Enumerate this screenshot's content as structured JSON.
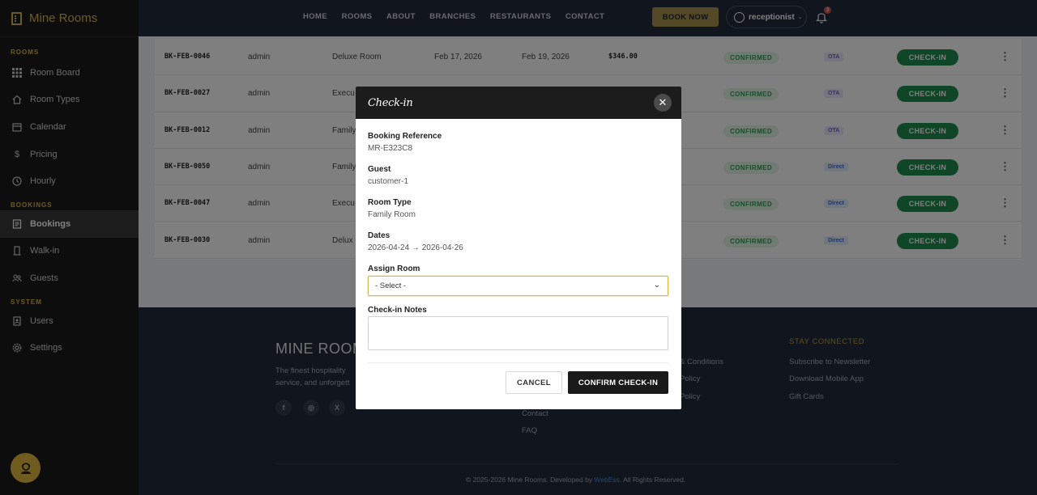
{
  "brand": {
    "name": "Mine Rooms"
  },
  "sidebar": {
    "sections": [
      {
        "title": "ROOMS",
        "items": [
          {
            "label": "Room Board",
            "icon": "grid-icon"
          },
          {
            "label": "Room Types",
            "icon": "home-icon"
          },
          {
            "label": "Calendar",
            "icon": "calendar-icon"
          },
          {
            "label": "Pricing",
            "icon": "dollar-icon"
          },
          {
            "label": "Hourly",
            "icon": "clock-icon"
          }
        ]
      },
      {
        "title": "BOOKINGS",
        "items": [
          {
            "label": "Bookings",
            "icon": "list-icon",
            "active": true
          },
          {
            "label": "Walk-in",
            "icon": "door-icon"
          },
          {
            "label": "Guests",
            "icon": "users-icon"
          }
        ]
      },
      {
        "title": "SYSTEM",
        "items": [
          {
            "label": "Users",
            "icon": "id-card-icon"
          },
          {
            "label": "Settings",
            "icon": "gear-icon"
          }
        ]
      }
    ]
  },
  "topnav": {
    "links": [
      "HOME",
      "ROOMS",
      "ABOUT",
      "BRANCHES",
      "RESTAURANTS",
      "CONTACT"
    ],
    "book_now": "BOOK NOW",
    "user": "receptionist",
    "notifications": "3"
  },
  "bookings": [
    {
      "ref": "BK-FEB-0046",
      "user": "admin",
      "room": "Deluxe Room",
      "check_in": "Feb 17, 2026",
      "check_out": "Feb 19, 2026",
      "price": "$346.00",
      "status": "CONFIRMED",
      "source": "OTA",
      "action": "CHECK-IN"
    },
    {
      "ref": "BK-FEB-0027",
      "user": "admin",
      "room": "Execu",
      "check_in": "",
      "check_out": "",
      "price": "",
      "status": "CONFIRMED",
      "source": "OTA",
      "action": "CHECK-IN"
    },
    {
      "ref": "BK-FEB-0012",
      "user": "admin",
      "room": "Family",
      "check_in": "",
      "check_out": "",
      "price": "",
      "status": "CONFIRMED",
      "source": "OTA",
      "action": "CHECK-IN"
    },
    {
      "ref": "BK-FEB-0050",
      "user": "admin",
      "room": "Family",
      "check_in": "",
      "check_out": "",
      "price": "",
      "status": "CONFIRMED",
      "source": "Direct",
      "action": "CHECK-IN"
    },
    {
      "ref": "BK-FEB-0047",
      "user": "admin",
      "room": "Execu",
      "check_in": "",
      "check_out": "",
      "price": "",
      "status": "CONFIRMED",
      "source": "Direct",
      "action": "CHECK-IN"
    },
    {
      "ref": "BK-FEB-0030",
      "user": "admin",
      "room": "Delux",
      "check_in": "",
      "check_out": "",
      "price": "",
      "status": "CONFIRMED",
      "source": "Direct",
      "action": "CHECK-IN"
    }
  ],
  "footer": {
    "title": "MINE ROOM",
    "description": "The finest hospitality service, and unforgett",
    "social": [
      "facebook-icon",
      "instagram-icon",
      "x-icon"
    ],
    "col2": [
      "Contact",
      "FAQ"
    ],
    "col3": [
      "& Conditions",
      "Policy",
      "Policy"
    ],
    "stay_connected": "STAY CONNECTED",
    "col4": [
      "Subscribe to Newsletter",
      "Download Mobile App",
      "Gift Cards"
    ],
    "copyright": "© 2025-2026 Mine Rooms. Developed by",
    "developer": "WebEss",
    "rights": ". All Rights Reserved."
  },
  "modal": {
    "title": "Check-in",
    "fields": [
      {
        "label": "Booking Reference",
        "value": "MR-E323C8"
      },
      {
        "label": "Guest",
        "value": "customer-1"
      },
      {
        "label": "Room Type",
        "value": "Family Room"
      },
      {
        "label": "Dates",
        "value": "2026-04-24 → 2026-04-26"
      }
    ],
    "assign_label": "Assign Room",
    "assign_value": "- Select -",
    "notes_label": "Check-in Notes",
    "notes_value": "",
    "cancel": "CANCEL",
    "confirm": "CONFIRM CHECK-IN"
  },
  "colors": {
    "accent": "#d9b64a",
    "sidebar": "#1b1b1b",
    "topnav": "#222c3c",
    "success": "#1e8c4e"
  }
}
